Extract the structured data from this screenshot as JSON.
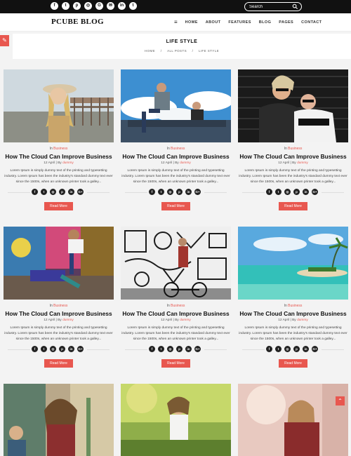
{
  "topbar": {
    "social": [
      {
        "icon": "facebook-icon",
        "glyph": "f"
      },
      {
        "icon": "twitter-icon",
        "glyph": "t"
      },
      {
        "icon": "pinterest-icon",
        "glyph": "p"
      },
      {
        "icon": "instagram-icon",
        "glyph": "◎"
      },
      {
        "icon": "google-plus-icon",
        "glyph": "G"
      },
      {
        "icon": "email-icon",
        "glyph": "✉"
      },
      {
        "icon": "linkedin-icon",
        "glyph": "in"
      },
      {
        "icon": "tumblr-icon",
        "glyph": "t"
      }
    ],
    "search_placeholder": "Search"
  },
  "header": {
    "logo": "PCUBE BLOG",
    "menu_glyph": "≡",
    "nav": [
      "HOME",
      "ABOUT",
      "FEATURES",
      "BLOG",
      "PAGES",
      "CONTACT"
    ]
  },
  "banner": {
    "heading": "LIFE STYLE",
    "crumbs": [
      "HOME",
      "/",
      "ALL POSTS",
      "/",
      "LIFE STYLE"
    ]
  },
  "colors": {
    "accent": "#e8574f",
    "dark": "#111111"
  },
  "posts": [
    {
      "category_prefix": "In",
      "category": "Business",
      "title": "How The Cloud Can Improve Business",
      "date": "12 April",
      "by": "By",
      "author": "dummy",
      "excerpt": "Lorem Ipsum is simply dummy text of the printing and typesetting industry. Lorem Ipsum has been the industry's standard dummy text ever since the 1500s, when an unknown printer took a galley...",
      "read_more": "Read More"
    },
    {
      "category_prefix": "In",
      "category": "Business",
      "title": "How The Cloud Can Improve Business",
      "date": "12 April",
      "by": "By",
      "author": "dummy",
      "excerpt": "Lorem Ipsum is simply dummy text of the printing and typesetting industry. Lorem Ipsum has been the industry's standard dummy text ever since the 1500s, when an unknown printer took a galley...",
      "read_more": "Read More"
    },
    {
      "category_prefix": "In",
      "category": "Business",
      "title": "How The Cloud Can Improve Business",
      "date": "12 April",
      "by": "By",
      "author": "dummy",
      "excerpt": "Lorem Ipsum is simply dummy text of the printing and typesetting industry. Lorem Ipsum has been the industry's standard dummy text ever since the 1500s, when an unknown printer took a galley...",
      "read_more": "Read More"
    },
    {
      "category_prefix": "In",
      "category": "Business",
      "title": "How The Cloud Can Improve Business",
      "date": "12 April",
      "by": "By",
      "author": "dummy",
      "excerpt": "Lorem Ipsum is simply dummy text of the printing and typesetting industry. Lorem Ipsum has been the industry's standard dummy text ever since the 1500s, when an unknown printer took a galley...",
      "read_more": "Read More"
    },
    {
      "category_prefix": "In",
      "category": "Business",
      "title": "How The Cloud Can Improve Business",
      "date": "12 April",
      "by": "By",
      "author": "dummy",
      "excerpt": "Lorem Ipsum is simply dummy text of the printing and typesetting industry. Lorem Ipsum has been the industry's standard dummy text ever since the 1500s, when an unknown printer took a galley...",
      "read_more": "Read More"
    },
    {
      "category_prefix": "In",
      "category": "Business",
      "title": "How The Cloud Can Improve Business",
      "date": "12 April",
      "by": "By",
      "author": "dummy",
      "excerpt": "Lorem Ipsum is simply dummy text of the printing and typesetting industry. Lorem Ipsum has been the industry's standard dummy text ever since the 1500s, when an unknown printer took a galley...",
      "read_more": "Read More"
    }
  ],
  "share_icons": [
    {
      "icon": "facebook-share-icon",
      "glyph": "f"
    },
    {
      "icon": "twitter-share-icon",
      "glyph": "t"
    },
    {
      "icon": "instagram-share-icon",
      "glyph": "◎"
    },
    {
      "icon": "pinterest-share-icon",
      "glyph": "p"
    },
    {
      "icon": "linkedin-share-icon",
      "glyph": "in"
    },
    {
      "icon": "google-plus-share-icon",
      "glyph": "G+"
    }
  ],
  "ui": {
    "brush_glyph": "✎",
    "to_top_glyph": "⌃"
  }
}
